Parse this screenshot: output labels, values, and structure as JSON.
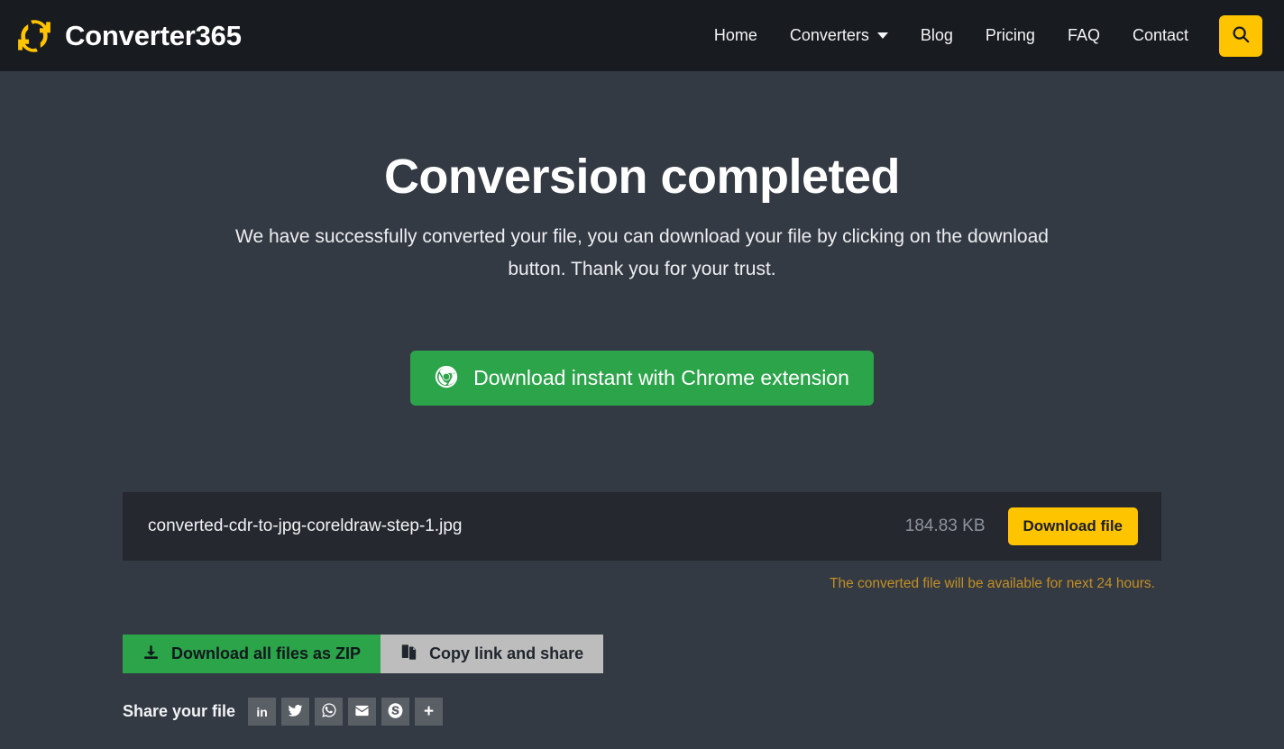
{
  "header": {
    "brand_name": "Converter365",
    "logo_icon": "convert-cycle-icon",
    "nav": [
      {
        "label": "Home",
        "icon": "",
        "has_caret": false
      },
      {
        "label": "Converters",
        "icon": "chevron-down-icon",
        "has_caret": true
      },
      {
        "label": "Blog",
        "icon": "",
        "has_caret": false
      },
      {
        "label": "Pricing",
        "icon": "",
        "has_caret": false
      },
      {
        "label": "FAQ",
        "icon": "",
        "has_caret": false
      },
      {
        "label": "Contact",
        "icon": "",
        "has_caret": false
      }
    ],
    "search_icon": "search-icon"
  },
  "hero": {
    "title": "Conversion completed",
    "subtitle": "We have successfully converted your file, you can download your file by clicking on the download button. Thank you for your trust."
  },
  "chrome_cta": {
    "label": "Download instant with Chrome extension",
    "icon": "chrome-icon"
  },
  "result": {
    "file_name": "converted-cdr-to-jpg-coreldraw-step-1.jpg",
    "file_size": "184.83 KB",
    "download_label": "Download file",
    "expiry_note": "The converted file will be available for next 24 hours."
  },
  "actions": {
    "zip_label": "Download all files as ZIP",
    "zip_icon": "download-icon",
    "copy_label": "Copy link and share",
    "copy_icon": "copy-files-icon"
  },
  "share": {
    "label": "Share your file",
    "items": [
      {
        "name": "linkedin",
        "icon": "linkedin-icon",
        "glyph": "in"
      },
      {
        "name": "twitter",
        "icon": "twitter-icon",
        "glyph": ""
      },
      {
        "name": "whatsapp",
        "icon": "whatsapp-icon",
        "glyph": ""
      },
      {
        "name": "email",
        "icon": "email-icon",
        "glyph": ""
      },
      {
        "name": "skype",
        "icon": "skype-icon",
        "glyph": ""
      },
      {
        "name": "more",
        "icon": "plus-icon",
        "glyph": "+"
      }
    ]
  },
  "colors": {
    "header_bg": "#181b1f",
    "page_bg": "#343a43",
    "accent_amber": "#ffc400",
    "accent_green": "#2ca44a",
    "file_bar_bg": "#25282e",
    "expiry_text": "#c28f26",
    "share_btn_bg": "#5a5f66"
  }
}
